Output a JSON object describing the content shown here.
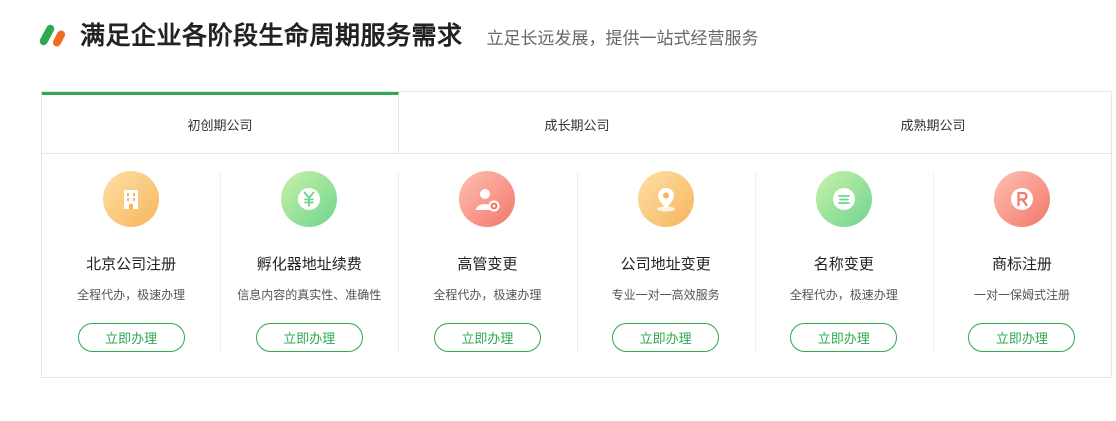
{
  "header": {
    "title": "满足企业各阶段生命周期服务需求",
    "subtitle": "立足长远发展，提供一站式经营服务"
  },
  "tabs": [
    {
      "label": "初创期公司",
      "active": true
    },
    {
      "label": "成长期公司",
      "active": false
    },
    {
      "label": "成熟期公司",
      "active": false
    }
  ],
  "services": [
    {
      "icon": "building-icon",
      "name": "北京公司注册",
      "desc": "全程代办，极速办理",
      "button": "立即办理",
      "color_from": "#fde0a8",
      "color_to": "#f7b55a"
    },
    {
      "icon": "yen-icon",
      "name": "孵化器地址续费",
      "desc": "信息内容的真实性、准确性",
      "button": "立即办理",
      "color_from": "#c9f2a8",
      "color_to": "#6fd48f"
    },
    {
      "icon": "user-gear-icon",
      "name": "高管变更",
      "desc": "全程代办，极速办理",
      "button": "立即办理",
      "color_from": "#ffc0b3",
      "color_to": "#f2776a"
    },
    {
      "icon": "location-pin-icon",
      "name": "公司地址变更",
      "desc": "专业一对一高效服务",
      "button": "立即办理",
      "color_from": "#fde0a8",
      "color_to": "#f7b55a"
    },
    {
      "icon": "chat-bubble-icon",
      "name": "名称变更",
      "desc": "全程代办，极速办理",
      "button": "立即办理",
      "color_from": "#c9f2a8",
      "color_to": "#6fd48f"
    },
    {
      "icon": "trademark-icon",
      "name": "商标注册",
      "desc": "一对一保姆式注册",
      "button": "立即办理",
      "color_from": "#ffc0b3",
      "color_to": "#f2776a"
    }
  ],
  "colors": {
    "accent": "#2fa84f",
    "logo_orange": "#f26b21"
  }
}
